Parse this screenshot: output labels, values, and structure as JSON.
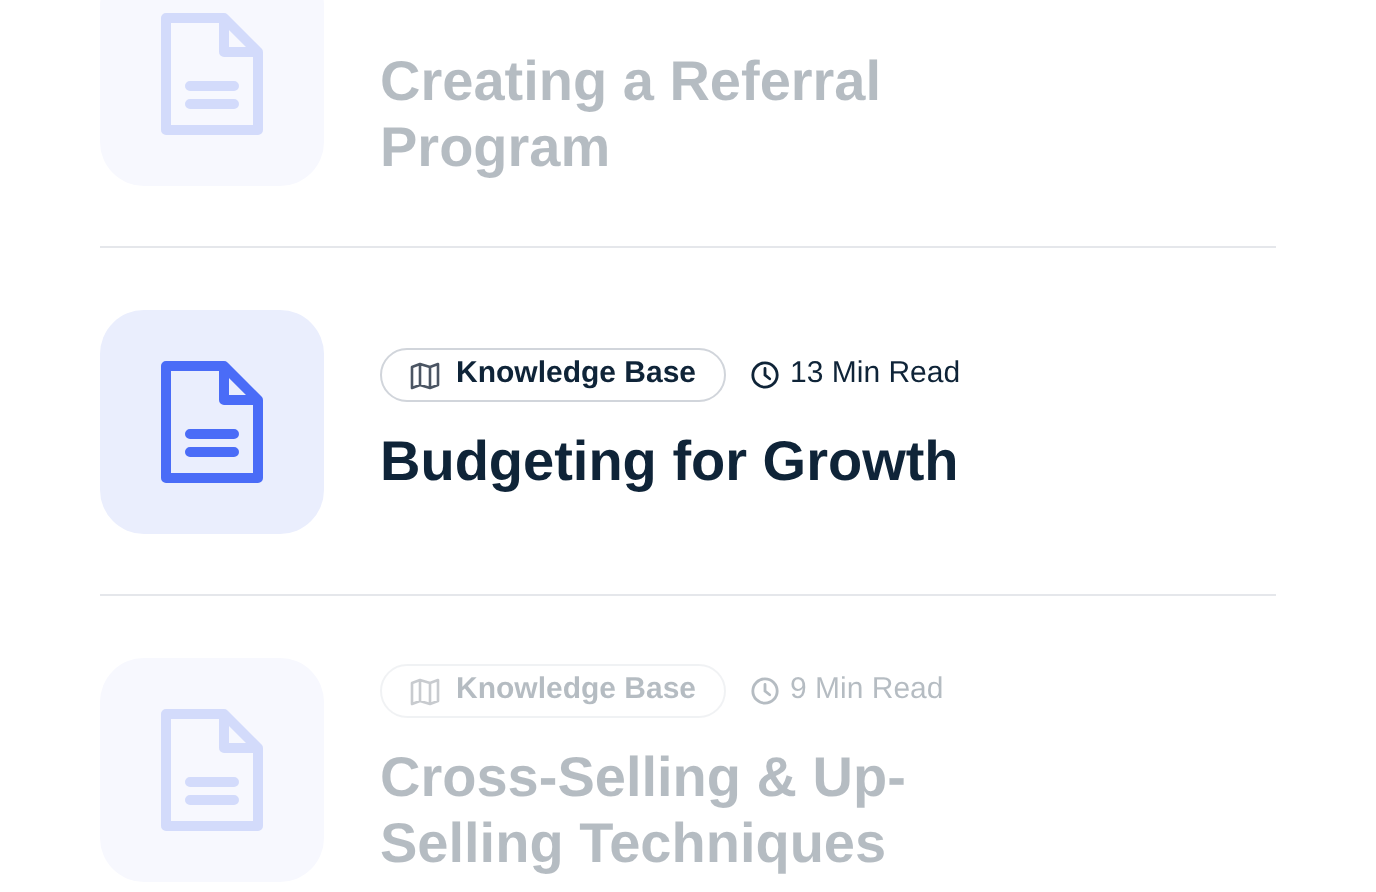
{
  "articles": [
    {
      "title": "Creating a Referral Program",
      "active": false
    },
    {
      "category": "Knowledge Base",
      "read_time": "13 Min Read",
      "title": "Budgeting for Growth",
      "active": true
    },
    {
      "category": "Knowledge Base",
      "read_time": "9 Min Read",
      "title": "Cross-Selling & Up-Selling Techniques",
      "active": false
    }
  ]
}
